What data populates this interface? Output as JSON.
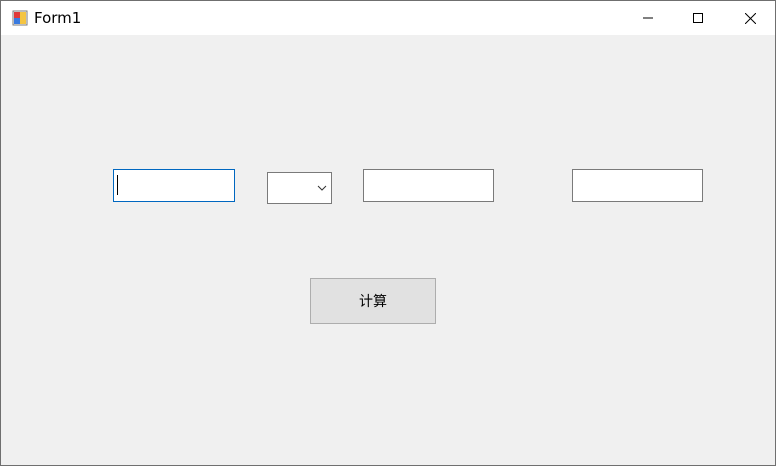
{
  "window": {
    "title": "Form1",
    "icon": "winforms-app-icon",
    "controls": {
      "minimize_icon": "minimize-icon",
      "maximize_icon": "maximize-icon",
      "close_icon": "close-icon"
    }
  },
  "form": {
    "input1": {
      "value": "",
      "placeholder": ""
    },
    "operator_combo": {
      "selected": "",
      "icon": "chevron-down-icon"
    },
    "input2": {
      "value": "",
      "placeholder": ""
    },
    "result": {
      "value": "",
      "placeholder": ""
    },
    "calculate_button": {
      "label": "计算"
    }
  },
  "colors": {
    "form_background": "#f0f0f0",
    "titlebar_background": "#ffffff",
    "focus_border": "#0067c0",
    "button_background": "#e1e1e1"
  }
}
